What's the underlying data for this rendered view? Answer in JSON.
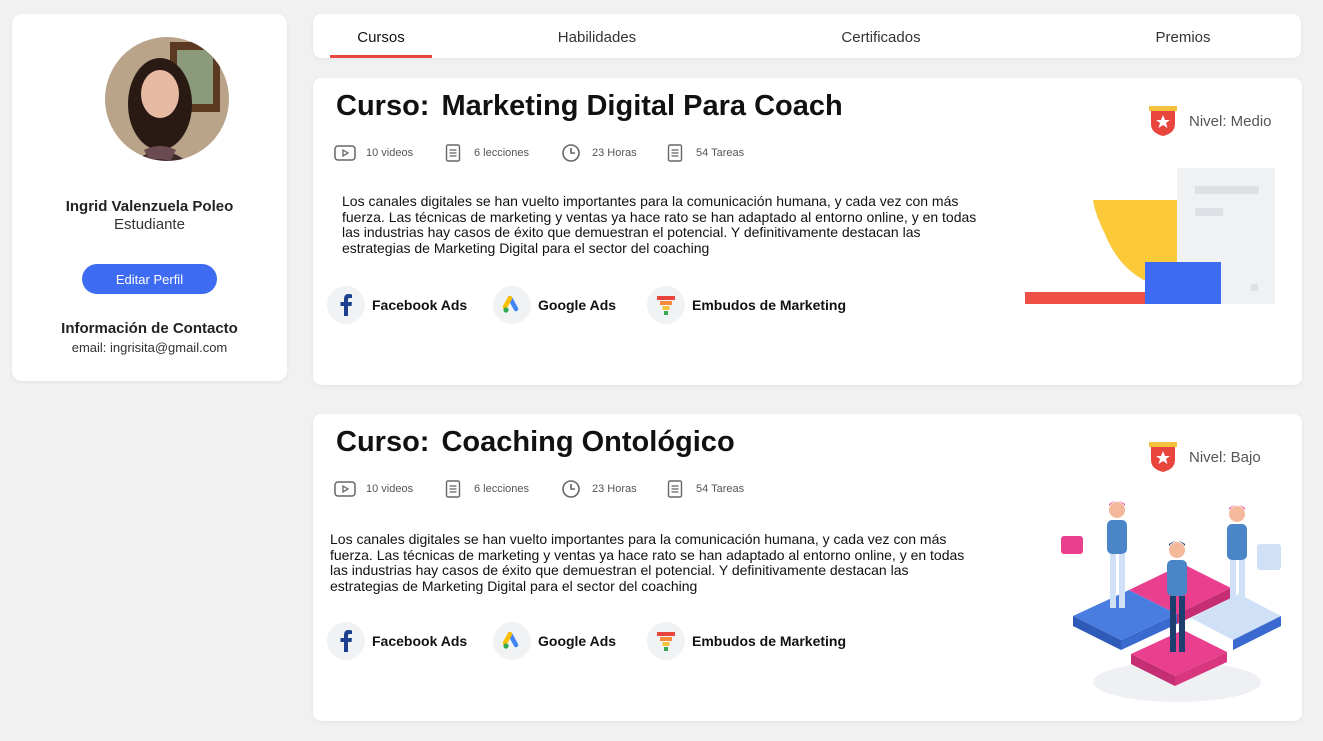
{
  "profile": {
    "name": "Ingrid Valenzuela Poleo",
    "role": "Estudiante",
    "edit_button": "Editar Perfil",
    "contact_title": "Información de Contacto",
    "email": "email:  ingrisita@gmail.com"
  },
  "tabs": [
    {
      "label": "Cursos",
      "active": true
    },
    {
      "label": "Habilidades",
      "active": false
    },
    {
      "label": "Certificados",
      "active": false
    },
    {
      "label": "Premios",
      "active": false
    }
  ],
  "courses": [
    {
      "title_prefix": "Curso:",
      "title": "Marketing Digital Para Coach",
      "level": "Nivel: Medio",
      "videos": "10 videos",
      "lessons": "6 lecciones",
      "hours": "23 Horas",
      "tasks": "54 Tareas",
      "description": "Los canales digitales se han vuelto importantes para la comunicación humana,  y cada vez con más fuerza. Las técnicas de marketing y ventas ya hace rato se han adaptado al entorno online, y en todas las industrias hay casos de éxito que demuestran el potencial. Y definitivamente destacan las estrategias de Marketing Digital para el sector del coaching",
      "skills": [
        "Facebook Ads",
        "Google Ads",
        "Embudos de Marketing"
      ]
    },
    {
      "title_prefix": "Curso:",
      "title": "Coaching Ontológico",
      "level": "Nivel: Bajo",
      "videos": "10 videos",
      "lessons": "6 lecciones",
      "hours": "23 Horas",
      "tasks": "54 Tareas",
      "description": "Los canales digitales se han vuelto importantes para la comunicación humana,  y cada vez con más fuerza. Las técnicas de marketing y ventas ya hace rato se han adaptado al entorno online, y en todas las industrias hay casos de éxito que demuestran el potencial. Y definitivamente destacan las estrategias de Marketing Digital para el sector del coaching",
      "skills": [
        "Facebook Ads",
        "Google Ads",
        "Embudos de Marketing"
      ]
    }
  ],
  "colors": {
    "accent_blue": "#3d6cf2",
    "tab_underline": "#e8453c",
    "badge_red": "#e8453c",
    "badge_gold": "#f5c33b",
    "facebook_blue": "#1d3f8f",
    "illustration_pink": "#e83e8c"
  },
  "icons": [
    "video-icon",
    "lessons-icon",
    "clock-icon",
    "tasks-icon",
    "facebook-icon",
    "google-ads-icon",
    "funnel-icon",
    "level-badge-icon"
  ]
}
